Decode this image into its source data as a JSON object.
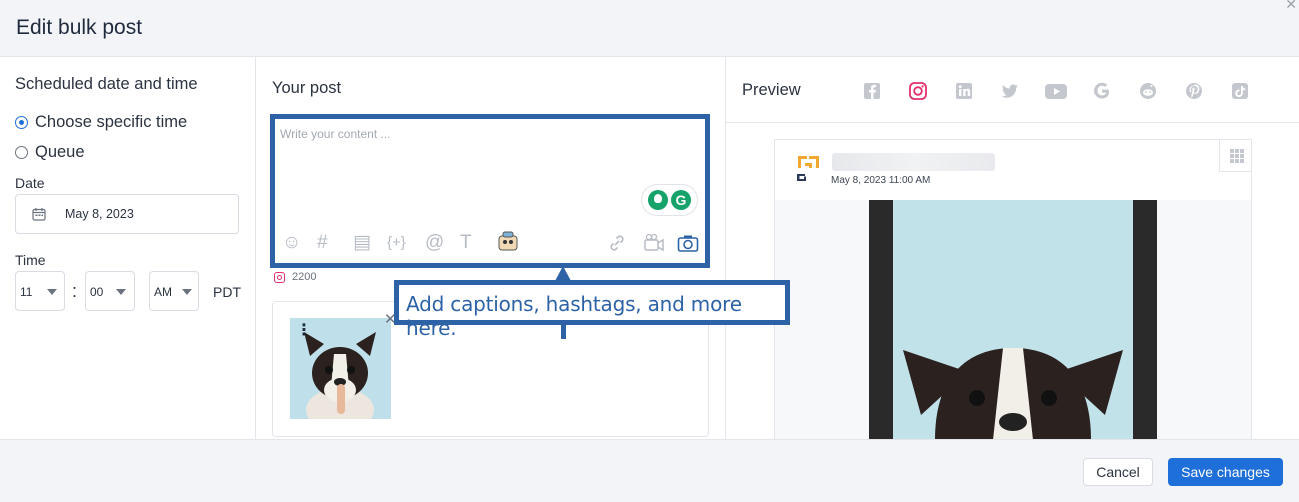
{
  "modal": {
    "title": "Edit bulk post"
  },
  "schedule": {
    "title": "Scheduled date and time",
    "options": [
      {
        "label": "Choose specific time",
        "selected": true
      },
      {
        "label": "Queue",
        "selected": false
      }
    ],
    "date_label": "Date",
    "date_value": "May 8, 2023",
    "time_label": "Time",
    "hour": "11",
    "minute": "00",
    "meridiem": "AM",
    "timezone": "PDT"
  },
  "post": {
    "title": "Your post",
    "placeholder": "Write your content ...",
    "toolbar_icons": [
      "emoji-icon",
      "hashtag-icon",
      "caption-icon",
      "variable-icon",
      "mention-icon",
      "text-format-icon",
      "sticker-icon",
      "link-icon",
      "video-icon",
      "camera-icon"
    ],
    "char_limit": "2200"
  },
  "callout": {
    "text": "Add captions, hashtags, and more here."
  },
  "preview": {
    "title": "Preview",
    "networks": [
      "facebook-icon",
      "instagram-icon",
      "linkedin-icon",
      "twitter-icon",
      "youtube-icon",
      "google-icon",
      "reddit-icon",
      "pinterest-icon",
      "tiktok-icon"
    ],
    "active_network": "instagram",
    "post_time": "May 8, 2023 11:00 AM"
  },
  "footer": {
    "cancel_label": "Cancel",
    "save_label": "Save changes"
  },
  "colors": {
    "accent": "#1e6fd9",
    "callout": "#2d62a6",
    "instagram": "#e1306c",
    "grammarly": "#15a36a"
  }
}
